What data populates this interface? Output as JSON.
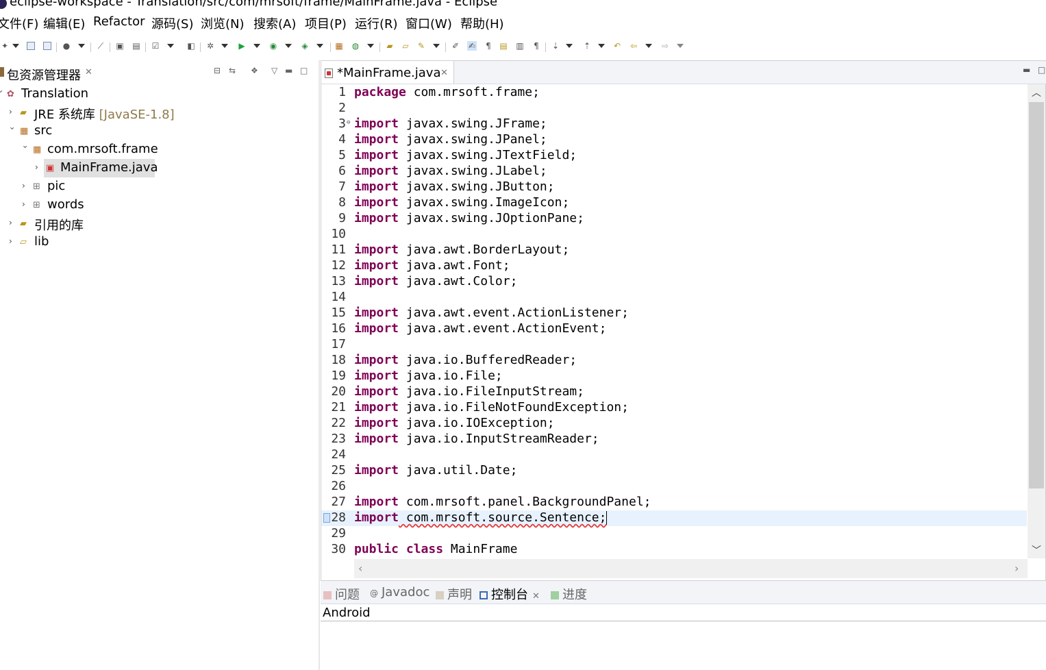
{
  "window": {
    "title": "eclipse-workspace - Translation/src/com/mrsoft/frame/MainFrame.java - Eclipse"
  },
  "menu": [
    "文件(F)",
    "编辑(E)",
    "Refactor",
    "源码(S)",
    "浏览(N)",
    "搜索(A)",
    "项目(P)",
    "运行(R)",
    "窗口(W)",
    "帮助(H)"
  ],
  "package_explorer": {
    "title": "包资源管理器",
    "tree": [
      {
        "label": "Translation",
        "icon": "project-icon"
      },
      {
        "label": "JRE 系统库",
        "suffix": "[JavaSE-1.8]",
        "icon": "library-icon"
      },
      {
        "label": "src",
        "icon": "source-folder-icon"
      },
      {
        "label": "com.mrsoft.frame",
        "icon": "package-icon"
      },
      {
        "label": "MainFrame.java",
        "icon": "java-file-icon"
      },
      {
        "label": "pic",
        "icon": "package-icon"
      },
      {
        "label": "words",
        "icon": "package-icon"
      },
      {
        "label": "引用的库",
        "icon": "library-icon"
      },
      {
        "label": "lib",
        "icon": "folder-icon"
      }
    ]
  },
  "editor": {
    "tab_label": "*MainFrame.java",
    "lines": [
      {
        "n": "1",
        "kw": "package",
        "rest": " com.mrsoft.frame;"
      },
      {
        "n": "2",
        "kw": "",
        "rest": ""
      },
      {
        "n": "3",
        "kw": "import",
        "rest": " javax.swing.JFrame;"
      },
      {
        "n": "4",
        "kw": "import",
        "rest": " javax.swing.JPanel;"
      },
      {
        "n": "5",
        "kw": "import",
        "rest": " javax.swing.JTextField;"
      },
      {
        "n": "6",
        "kw": "import",
        "rest": " javax.swing.JLabel;"
      },
      {
        "n": "7",
        "kw": "import",
        "rest": " javax.swing.JButton;"
      },
      {
        "n": "8",
        "kw": "import",
        "rest": " javax.swing.ImageIcon;"
      },
      {
        "n": "9",
        "kw": "import",
        "rest": " javax.swing.JOptionPane;"
      },
      {
        "n": "10",
        "kw": "",
        "rest": ""
      },
      {
        "n": "11",
        "kw": "import",
        "rest": " java.awt.BorderLayout;"
      },
      {
        "n": "12",
        "kw": "import",
        "rest": " java.awt.Font;"
      },
      {
        "n": "13",
        "kw": "import",
        "rest": " java.awt.Color;"
      },
      {
        "n": "14",
        "kw": "",
        "rest": ""
      },
      {
        "n": "15",
        "kw": "import",
        "rest": " java.awt.event.ActionListener;"
      },
      {
        "n": "16",
        "kw": "import",
        "rest": " java.awt.event.ActionEvent;"
      },
      {
        "n": "17",
        "kw": "",
        "rest": ""
      },
      {
        "n": "18",
        "kw": "import",
        "rest": " java.io.BufferedReader;"
      },
      {
        "n": "19",
        "kw": "import",
        "rest": " java.io.File;"
      },
      {
        "n": "20",
        "kw": "import",
        "rest": " java.io.FileInputStream;"
      },
      {
        "n": "21",
        "kw": "import",
        "rest": " java.io.FileNotFoundException;"
      },
      {
        "n": "22",
        "kw": "import",
        "rest": " java.io.IOException;"
      },
      {
        "n": "23",
        "kw": "import",
        "rest": " java.io.InputStreamReader;"
      },
      {
        "n": "24",
        "kw": "",
        "rest": ""
      },
      {
        "n": "25",
        "kw": "import",
        "rest": " java.util.Date;"
      },
      {
        "n": "26",
        "kw": "",
        "rest": ""
      },
      {
        "n": "27",
        "kw": "import",
        "rest": " com.mrsoft.panel.BackgroundPanel;"
      },
      {
        "n": "28",
        "kw": "import",
        "rest": " com.mrsoft.source.Sentence;"
      },
      {
        "n": "29",
        "kw": "",
        "rest": ""
      },
      {
        "n": "30",
        "kw": "public class",
        "rest": " MainFrame"
      }
    ]
  },
  "bottom_panel": {
    "tabs": [
      "问题",
      "Javadoc",
      "声明",
      "控制台",
      "进度"
    ],
    "active_tab": "控制台",
    "console_text": "Android"
  }
}
